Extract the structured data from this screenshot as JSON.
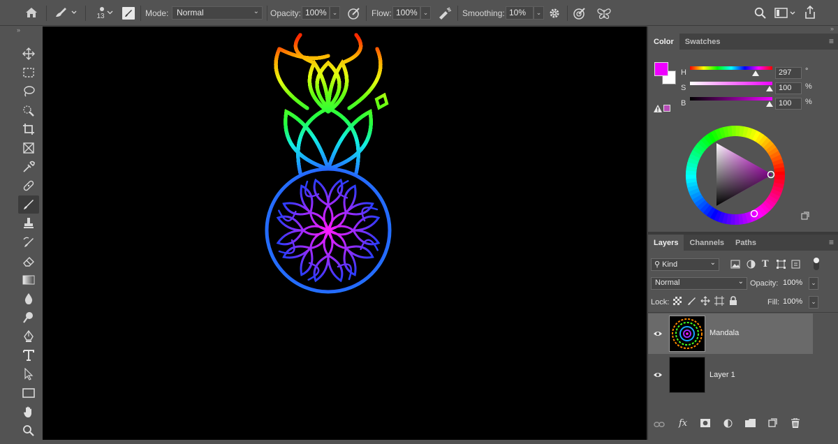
{
  "options_bar": {
    "brush_size": "13",
    "mode_label": "Mode:",
    "mode_value": "Normal",
    "opacity_label": "Opacity:",
    "opacity_value": "100%",
    "flow_label": "Flow:",
    "flow_value": "100%",
    "smoothing_label": "Smoothing:",
    "smoothing_value": "10%"
  },
  "color_panel": {
    "tabs": [
      "Color",
      "Swatches"
    ],
    "h_label": "H",
    "s_label": "S",
    "b_label": "B",
    "h_value": "297",
    "s_value": "100",
    "b_value": "100",
    "h_unit": "°",
    "s_unit": "%",
    "b_unit": "%",
    "foreground_color": "#ee00ff",
    "background_color": "#ffffff"
  },
  "layers_panel": {
    "tabs": [
      "Layers",
      "Channels",
      "Paths"
    ],
    "filter_value": "Kind",
    "blend_mode": "Normal",
    "opacity_label": "Opacity:",
    "opacity_value": "100%",
    "lock_label": "Lock:",
    "fill_label": "Fill:",
    "fill_value": "100%",
    "layers": [
      {
        "name": "Mandala",
        "selected": true
      },
      {
        "name": "Layer 1",
        "selected": false
      }
    ],
    "bottom_icons": [
      "link-icon",
      "fx-icon",
      "mask-icon",
      "adjustment-icon",
      "group-folder-icon",
      "new-layer-icon",
      "trash-icon"
    ]
  },
  "toolbar": {
    "tools": [
      "move-tool",
      "marquee-tool",
      "lasso-tool",
      "quick-select-tool",
      "crop-tool",
      "frame-tool",
      "eyedropper-tool",
      "healing-tool",
      "brush-tool",
      "stamp-tool",
      "history-brush-tool",
      "eraser-tool",
      "gradient-tool",
      "blur-tool",
      "dodge-tool",
      "pen-tool",
      "type-tool",
      "path-select-tool",
      "rectangle-tool",
      "hand-tool",
      "zoom-tool"
    ],
    "active_tool": "brush-tool"
  },
  "canvas": {
    "content": "mandala-artwork"
  }
}
